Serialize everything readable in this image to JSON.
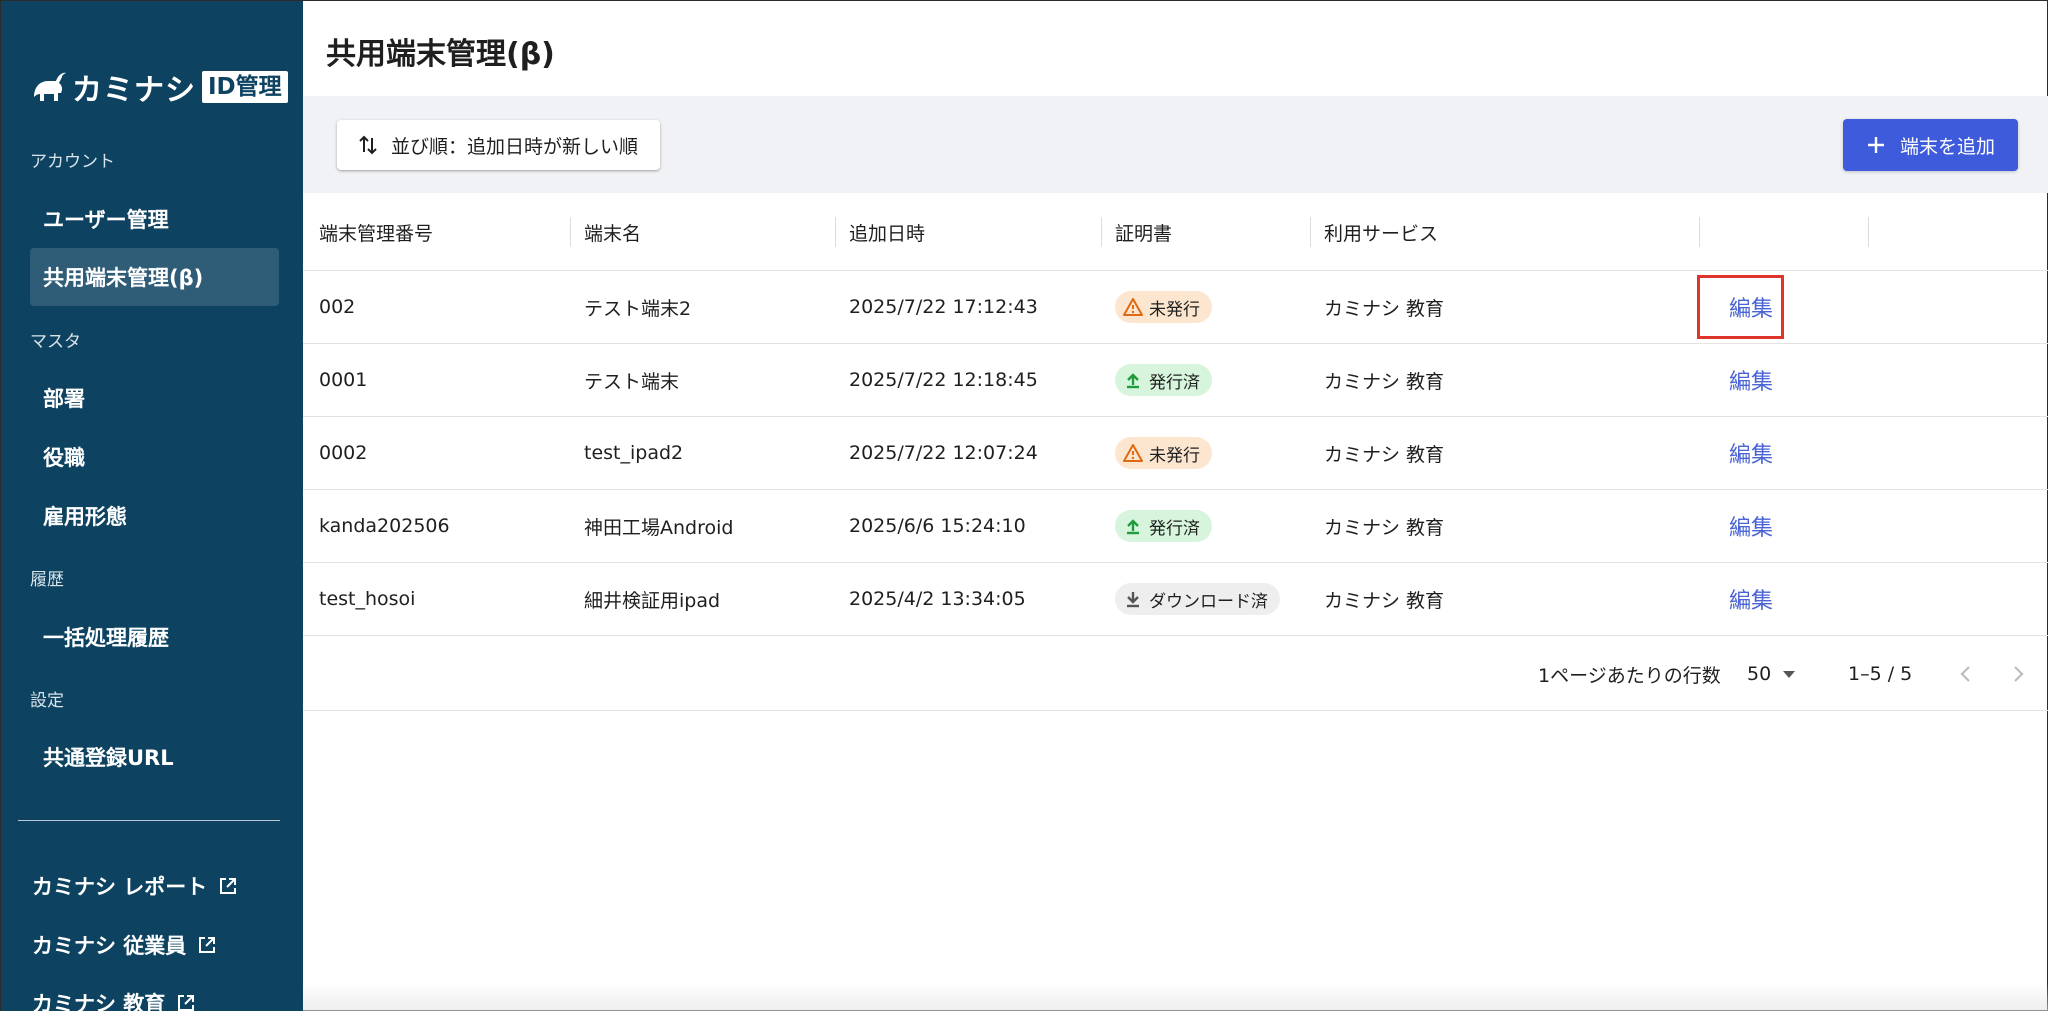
{
  "sidebar": {
    "logo_text": "カミナシ",
    "logo_badge": "ID管理",
    "sections": [
      {
        "label": "アカウント"
      },
      {
        "label": "マスタ"
      },
      {
        "label": "履歴"
      },
      {
        "label": "設定"
      }
    ],
    "items": [
      {
        "label": "ユーザー管理"
      },
      {
        "label": "共用端末管理(β)",
        "active": true
      },
      {
        "label": "部署"
      },
      {
        "label": "役職"
      },
      {
        "label": "雇用形態"
      },
      {
        "label": "一括処理履歴"
      },
      {
        "label": "共通登録URL"
      }
    ],
    "external_links": [
      {
        "label": "カミナシ レポート"
      },
      {
        "label": "カミナシ 従業員"
      },
      {
        "label": "カミナシ 教育"
      }
    ]
  },
  "page": {
    "title": "共用端末管理(β)"
  },
  "toolbar": {
    "sort_label": "並び順：追加日時が新しい順",
    "add_label": "端末を追加"
  },
  "table": {
    "headers": [
      "端末管理番号",
      "端末名",
      "追加日時",
      "証明書",
      "利用サービス"
    ],
    "edit_label": "編集",
    "rows": [
      {
        "id": "002",
        "name": "テスト端末2",
        "added": "2025/7/22 17:12:43",
        "cert": "未発行",
        "cert_status": "warning",
        "service": "カミナシ 教育"
      },
      {
        "id": "0001",
        "name": "テスト端末",
        "added": "2025/7/22 12:18:45",
        "cert": "発行済",
        "cert_status": "issued",
        "service": "カミナシ 教育"
      },
      {
        "id": "0002",
        "name": "test_ipad2",
        "added": "2025/7/22 12:07:24",
        "cert": "未発行",
        "cert_status": "warning",
        "service": "カミナシ 教育"
      },
      {
        "id": "kanda202506",
        "name": "神田工場Android",
        "added": "2025/6/6 15:24:10",
        "cert": "発行済",
        "cert_status": "issued",
        "service": "カミナシ 教育"
      },
      {
        "id": "test_hosoi",
        "name": "細井検証用ipad",
        "added": "2025/4/2 13:34:05",
        "cert": "ダウンロード済",
        "cert_status": "downloaded",
        "service": "カミナシ 教育"
      }
    ]
  },
  "pagination": {
    "rows_per_page_label": "1ページあたりの行数",
    "rows_per_page": "50",
    "range": "1–5 / 5"
  },
  "colors": {
    "sidebar_bg": "#0d4260",
    "accent": "#3e5bdc",
    "warning_chip": "#fde6cf",
    "issued_chip": "#d6f5dc",
    "downloaded_chip": "#eeeeee",
    "highlight": "#e0332b"
  },
  "icons": {
    "logo": "goat-icon",
    "sort": "sort-arrows-icon",
    "add": "plus-icon",
    "warning": "warning-triangle-icon",
    "issued": "upload-icon",
    "downloaded": "download-icon",
    "external": "external-link-icon",
    "prev": "chevron-left-icon",
    "next": "chevron-right-icon"
  }
}
